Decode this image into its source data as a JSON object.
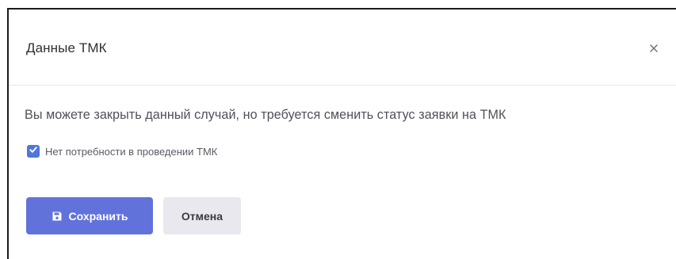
{
  "dialog": {
    "title": "Данные ТМК",
    "close_label": "×"
  },
  "body": {
    "message": "Вы можете закрыть данный случай, но требуется сменить статус заявки на ТМК",
    "checkbox": {
      "label": "Нет потребности в проведении ТМК",
      "checked": true
    }
  },
  "actions": {
    "save_label": "Сохранить",
    "cancel_label": "Отмена"
  },
  "icons": {
    "close": "close-icon",
    "check": "check-icon",
    "save": "save-icon"
  },
  "colors": {
    "primary": "#6272db",
    "checkbox": "#4f76d8",
    "secondary_button": "#e8e8ee"
  }
}
